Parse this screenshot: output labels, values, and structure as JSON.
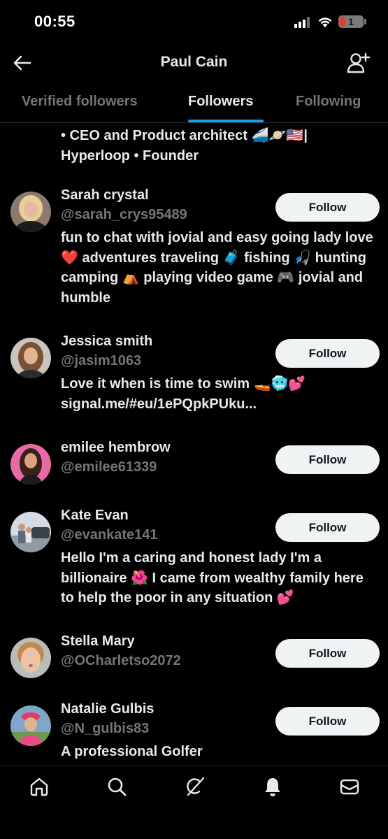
{
  "status_bar": {
    "time": "00:55",
    "battery_level": "1",
    "battery_color": "#e53935"
  },
  "header": {
    "title": "Paul Cain",
    "back_icon": "arrow-left-icon",
    "add_icon": "add-user-icon"
  },
  "tabs": [
    {
      "label": "Verified followers",
      "active": false
    },
    {
      "label": "Followers",
      "active": true
    },
    {
      "label": "Following",
      "active": false
    }
  ],
  "partial_bio": "• CEO and Product architect 🚄🪐🇺🇸| Hyperloop • Founder",
  "followers": [
    {
      "name": "Sarah crystal",
      "handle": "@sarah_crys95489",
      "bio": "fun to chat with jovial and easy going lady love ❤️ adventures traveling 🧳 fishing 🎣 hunting camping ⛺ playing video game 🎮 jovial and humble",
      "button": "Follow"
    },
    {
      "name": "Jessica smith",
      "handle": "@jasim1063",
      "bio": "Love it when is time to swim 🚤🥶💕 signal.me/#eu/1ePQpkPUku...",
      "button": "Follow"
    },
    {
      "name": "emilee hembrow",
      "handle": "@emilee61339",
      "bio": "",
      "button": "Follow"
    },
    {
      "name": "Kate Evan",
      "handle": "@evankate141",
      "bio": "Hello I'm a caring and honest lady I'm a billionaire 🌺 I came from wealthy family here to help the poor in any situation 💕",
      "button": "Follow"
    },
    {
      "name": "Stella Mary",
      "handle": "@OCharletso2072",
      "bio": "",
      "button": "Follow"
    },
    {
      "name": "Natalie Gulbis",
      "handle": "@N_gulbis83",
      "bio": "A professional Golfer",
      "button": "Follow"
    }
  ],
  "bottom_nav": [
    {
      "icon": "home-icon"
    },
    {
      "icon": "search-icon"
    },
    {
      "icon": "grok-icon"
    },
    {
      "icon": "notifications-bell-icon"
    },
    {
      "icon": "messages-envelope-icon"
    }
  ],
  "colors": {
    "accent": "#1d9bf0",
    "background": "#000000",
    "primary_text": "#e7e9ea",
    "secondary_text": "#71767b",
    "follow_button": "#eff3f4"
  }
}
